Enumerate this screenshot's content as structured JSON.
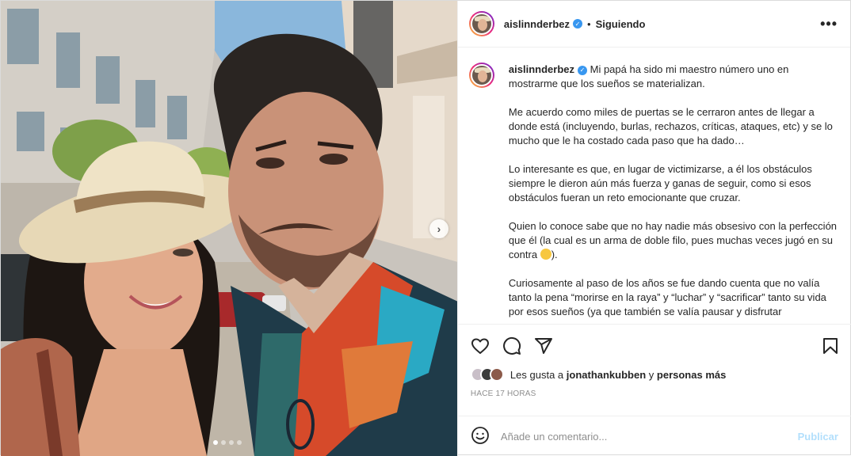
{
  "post": {
    "author": "aislinnderbez",
    "follow_status": "Siguiendo",
    "header_separator": "•",
    "more_label": "•••",
    "colors": {
      "accent": "#3897f0",
      "publish_disabled": "#b2dffc",
      "muted": "#8e8e8e"
    }
  },
  "media": {
    "next_label": "›",
    "carousel_count": 4,
    "carousel_active": 0
  },
  "caption": {
    "username": "aislinnderbez",
    "paragraphs": [
      "Mi papá ha sido mi maestro número uno en mostrarme que los sueños se materializan.",
      "Me acuerdo como miles de puertas se le cerraron antes de llegar a donde está (incluyendo, burlas, rechazos, críticas, ataques, etc) y se lo mucho que le ha costado cada paso que ha dado…",
      "Lo interesante es que, en lugar de victimizarse, a él los obstáculos siempre le dieron aún más fuerza y ganas de seguir, como si esos obstáculos fueran un reto emocionante que cruzar.",
      "Quien lo conoce sabe que no hay nadie más obsesivo con la perfección que él (la cual es un arma de doble filo, pues muchas veces jugó en su contra",
      "Curiosamente al paso de los años se fue dando cuenta que no valía tanto la pena “morirse en la raya” y “luchar” y “sacrificar” tanto su vida por esos sueños (ya que también se valía pausar y disfrutar"
    ],
    "para4_suffix": ")."
  },
  "actions": {
    "icons": [
      "heart-icon",
      "comment-icon",
      "share-icon",
      "bookmark-icon"
    ]
  },
  "likes": {
    "prefix": "Les gusta a",
    "user": "jonathankubben",
    "joiner": "y",
    "others": "personas más"
  },
  "timestamp": "HACE 17 HORAS",
  "comment": {
    "placeholder": "Añade un comentario...",
    "publish_label": "Publicar"
  }
}
